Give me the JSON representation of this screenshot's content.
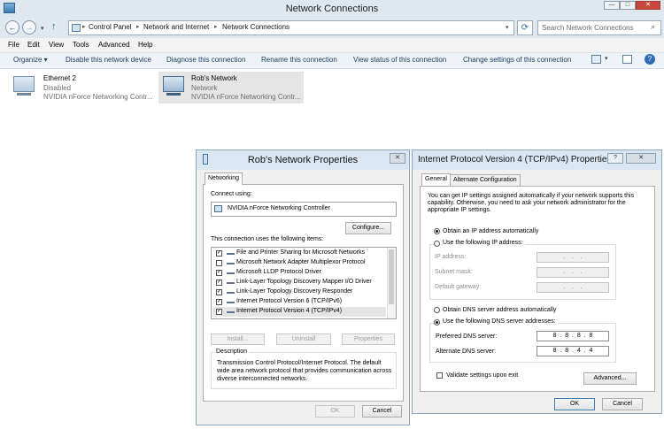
{
  "window": {
    "title": "Network Connections",
    "min": "—",
    "max": "□",
    "close": "✕"
  },
  "nav": {
    "back": "←",
    "forward": "→",
    "up": "↑",
    "refresh": "⟳",
    "breadcrumbs": [
      "Control Panel",
      "Network and Internet",
      "Network Connections"
    ],
    "search_placeholder": "Search Network Connections"
  },
  "menu": [
    "File",
    "Edit",
    "View",
    "Tools",
    "Advanced",
    "Help"
  ],
  "commands": {
    "organize": "Organize ▾",
    "disable": "Disable this network device",
    "diagnose": "Diagnose this connection",
    "rename": "Rename this connection",
    "status": "View status of this connection",
    "change": "Change settings of this connection"
  },
  "adapters": [
    {
      "name": "Ethernet 2",
      "status": "Disabled",
      "device": "NVIDIA nForce Networking Contr..."
    },
    {
      "name": "Rob's Network",
      "status": "Network",
      "device": "NVIDIA nForce Networking Contr..."
    }
  ],
  "props": {
    "title": "Rob's Network Properties",
    "tab": "Networking",
    "connect_using_label": "Connect using:",
    "adapter": "NVIDIA nForce Networking Controller",
    "configure": "Configure...",
    "items_label": "This connection uses the following items:",
    "items": [
      {
        "label": "File and Printer Sharing for Microsoft Networks",
        "checked": "✓"
      },
      {
        "label": "Microsoft Network Adapter Multiplexor Protocol",
        "checked": ""
      },
      {
        "label": "Microsoft LLDP Protocol Driver",
        "checked": "✓"
      },
      {
        "label": "Link-Layer Topology Discovery Mapper I/O Driver",
        "checked": "✓"
      },
      {
        "label": "Link-Layer Topology Discovery Responder",
        "checked": "✓"
      },
      {
        "label": "Internet Protocol Version 6 (TCP/IPv6)",
        "checked": "✓"
      },
      {
        "label": "Internet Protocol Version 4 (TCP/IPv4)",
        "checked": "✓"
      }
    ],
    "install": "Install...",
    "uninstall": "Uninstall",
    "properties": "Properties",
    "description_label": "Description",
    "description": "Transmission Control Protocol/Internet Protocol. The default wide area network protocol that provides communication across diverse interconnected networks.",
    "ok": "OK",
    "cancel": "Cancel"
  },
  "ipv4": {
    "title": "Internet Protocol Version 4 (TCP/IPv4) Properties",
    "help": "?",
    "close": "✕",
    "tab_general": "General",
    "tab_alternate": "Alternate Configuration",
    "intro": "You can get IP settings assigned automatically if your network supports this capability. Otherwise, you need to ask your network administrator for the appropriate IP settings.",
    "obtain_ip": "Obtain an IP address automatically",
    "use_ip": "Use the following IP address:",
    "ip_address_label": "IP address:",
    "subnet_label": "Subnet mask:",
    "gateway_label": "Default gateway:",
    "empty_ip": " .    .    . ",
    "obtain_dns": "Obtain DNS server address automatically",
    "use_dns": "Use the following DNS server addresses:",
    "preferred_label": "Preferred DNS server:",
    "alternate_label": "Alternate DNS server:",
    "preferred_value": "8  .  8  .  8  .  8",
    "alternate_value": "8  .  8  .  4  .  4",
    "validate": "Validate settings upon exit",
    "advanced": "Advanced...",
    "ok": "OK",
    "cancel": "Cancel"
  },
  "colors": {
    "title_bar": "#dfe8ef",
    "command_bar": "#eef3f8",
    "dialog_border": "#89a7c2",
    "selection": "#e5e5e5"
  }
}
